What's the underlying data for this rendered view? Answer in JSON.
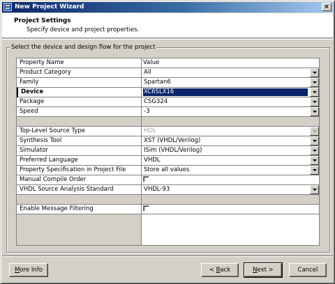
{
  "window": {
    "title": "New Project Wizard",
    "close_label": "×"
  },
  "header": {
    "title": "Project Settings",
    "subtitle": "Specify device and project properties."
  },
  "group": {
    "label": "Select the device and design flow for the project"
  },
  "grid": {
    "columns": {
      "name": "Property Name",
      "value": "Value"
    },
    "rows": [
      {
        "name": "Product Category",
        "value": "All",
        "type": "combo"
      },
      {
        "name": "Family",
        "value": "Spartan6",
        "type": "combo"
      },
      {
        "name": "Device",
        "value": "XC6SLX16",
        "type": "combo",
        "selected": true
      },
      {
        "name": "Package",
        "value": "CSG324",
        "type": "combo"
      },
      {
        "name": "Speed",
        "value": "-3",
        "type": "combo"
      },
      {
        "name": "",
        "value": "",
        "type": "blank"
      },
      {
        "name": "Top-Level Source Type",
        "value": "HDL",
        "type": "combo",
        "disabled": true
      },
      {
        "name": "Synthesis Tool",
        "value": "XST (VHDL/Verilog)",
        "type": "combo"
      },
      {
        "name": "Simulator",
        "value": "ISim (VHDL/Verilog)",
        "type": "combo"
      },
      {
        "name": "Preferred Language",
        "value": "VHDL",
        "type": "combo"
      },
      {
        "name": "Property Specification in Project File",
        "value": "Store all values",
        "type": "combo"
      },
      {
        "name": "Manual Compile Order",
        "value": "",
        "type": "checkbox"
      },
      {
        "name": "VHDL Source Analysis Standard",
        "value": "VHDL-93",
        "type": "combo"
      },
      {
        "name": "",
        "value": "",
        "type": "blank"
      },
      {
        "name": "Enable Message Filtering",
        "value": "",
        "type": "checkbox"
      }
    ]
  },
  "buttons": {
    "more_info": {
      "prefix": "",
      "mnemonic": "M",
      "rest": "ore Info"
    },
    "back": {
      "prefix": "< ",
      "mnemonic": "B",
      "rest": "ack"
    },
    "next": {
      "prefix": "",
      "mnemonic": "N",
      "rest": "ext >"
    },
    "cancel": "Cancel"
  }
}
